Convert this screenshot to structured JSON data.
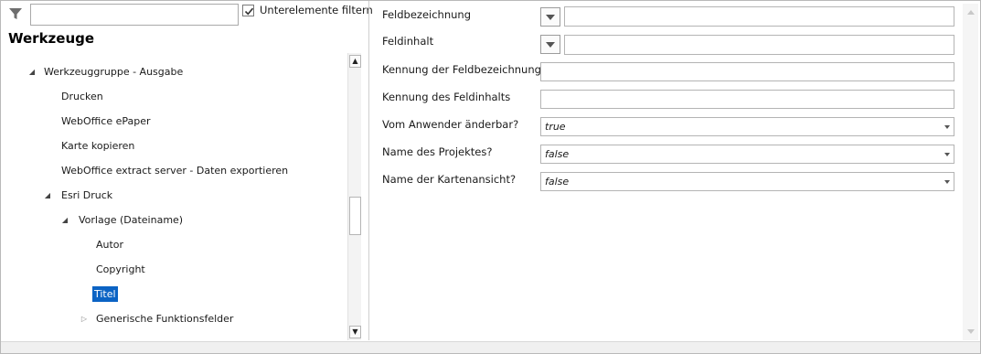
{
  "filter": {
    "input_value": "",
    "checkbox_label": "Unterelemente filtern",
    "checked": true
  },
  "panel": {
    "title": "Werkzeuge"
  },
  "tree": {
    "nodes": [
      {
        "label": "Werkzeuggruppe - Ausgabe",
        "expander": "expanded",
        "selected": false
      },
      {
        "label": "Drucken",
        "expander": "none",
        "selected": false
      },
      {
        "label": "WebOffice ePaper",
        "expander": "none",
        "selected": false
      },
      {
        "label": "Karte kopieren",
        "expander": "none",
        "selected": false
      },
      {
        "label": "WebOffice extract server - Daten exportieren",
        "expander": "none",
        "selected": false
      },
      {
        "label": "Esri Druck",
        "expander": "expanded",
        "selected": false
      },
      {
        "label": "Vorlage (Dateiname)",
        "expander": "expanded",
        "selected": false
      },
      {
        "label": "Autor",
        "expander": "none",
        "selected": false
      },
      {
        "label": "Copyright",
        "expander": "none",
        "selected": false
      },
      {
        "label": "Titel",
        "expander": "none",
        "selected": true
      },
      {
        "label": "Generische Funktionsfelder",
        "expander": "collapsed",
        "selected": false
      }
    ]
  },
  "icons": {
    "filter": "funnel-icon",
    "check": "checkmark-icon",
    "expanded": "triangle-expanded-icon",
    "collapsed": "triangle-collapsed-icon",
    "scroll_up": "scroll-up-icon",
    "scroll_down": "scroll-down-icon",
    "dropdown": "chevron-down-icon"
  },
  "properties": {
    "field_name": {
      "label": "Feldbezeichnung",
      "value": ""
    },
    "field_content": {
      "label": "Feldinhalt",
      "value": ""
    },
    "field_name_id": {
      "label": "Kennung der Feldbezeichnung",
      "value": ""
    },
    "field_content_id": {
      "label": "Kennung des Feldinhalts",
      "value": ""
    },
    "user_editable": {
      "label": "Vom Anwender änderbar?",
      "value": "true"
    },
    "project_name": {
      "label": "Name des Projektes?",
      "value": "false"
    },
    "map_view_name": {
      "label": "Name der Kartenansicht?",
      "value": "false"
    }
  },
  "colors": {
    "selection": "#0b63c4",
    "border": "#b4b4b4"
  }
}
